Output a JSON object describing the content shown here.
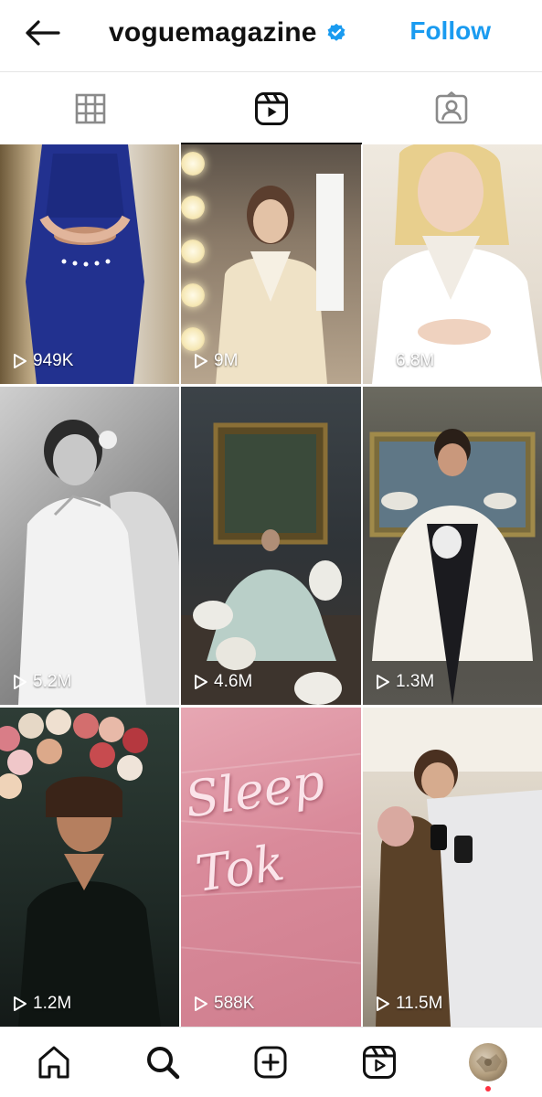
{
  "header": {
    "username": "voguemagazine",
    "follow_label": "Follow",
    "accent_color": "#1a9bf0"
  },
  "tabs": [
    {
      "name": "grid-icon",
      "active": false
    },
    {
      "name": "reels-icon",
      "active": true
    },
    {
      "name": "tagged-icon",
      "active": false
    }
  ],
  "reels": [
    {
      "views": "949K"
    },
    {
      "views": "9M"
    },
    {
      "views": "6.8M"
    },
    {
      "views": "5.2M"
    },
    {
      "views": "4.6M"
    },
    {
      "views": "1.3M"
    },
    {
      "views": "1.2M"
    },
    {
      "views": "588K",
      "overlay_text": "Sleep Tok"
    },
    {
      "views": "11.5M"
    }
  ],
  "bottom_nav": [
    {
      "icon": "home-icon"
    },
    {
      "icon": "search-icon"
    },
    {
      "icon": "create-icon"
    },
    {
      "icon": "reels-icon"
    },
    {
      "icon": "profile-avatar",
      "notification_dot": true
    }
  ]
}
